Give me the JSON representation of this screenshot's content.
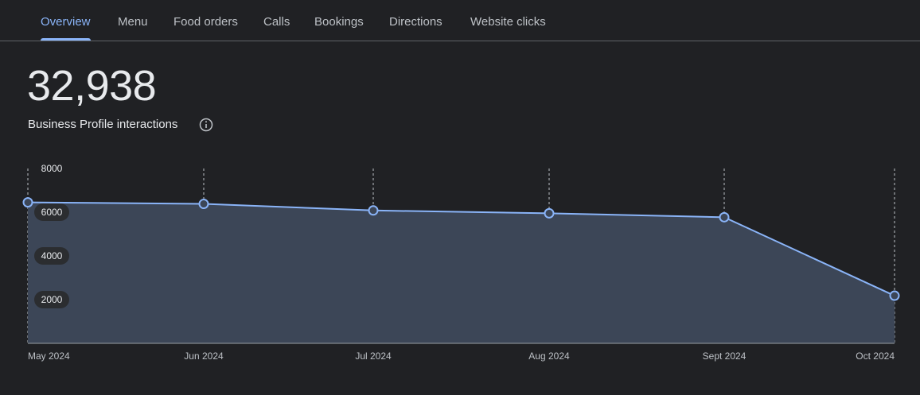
{
  "tabs": [
    {
      "label": "Overview",
      "active": true
    },
    {
      "label": "Menu",
      "active": false
    },
    {
      "label": "Food orders",
      "active": false
    },
    {
      "label": "Calls",
      "active": false
    },
    {
      "label": "Bookings",
      "active": false
    },
    {
      "label": "Directions",
      "active": false
    },
    {
      "label": "Website clicks",
      "active": false
    }
  ],
  "summary": {
    "total": "32,938",
    "label": "Business Profile interactions",
    "info_icon": "info-icon"
  },
  "colors": {
    "background": "#202124",
    "accent": "#8ab4f8",
    "area_fill": "#3c4657",
    "text": "#e8eaed",
    "muted_text": "#bdc1c6"
  },
  "chart_data": {
    "type": "area",
    "x": [
      "May 2024",
      "Jun 2024",
      "Jul 2024",
      "Aug 2024",
      "Sept 2024",
      "Oct 2024"
    ],
    "values": [
      6450,
      6380,
      6080,
      5950,
      5770,
      2180
    ],
    "yticks": [
      "8000",
      "6000",
      "4000",
      "2000"
    ],
    "ylim": [
      0,
      8000
    ],
    "grid": "vertical dashed lines at each month",
    "legend": "none"
  }
}
